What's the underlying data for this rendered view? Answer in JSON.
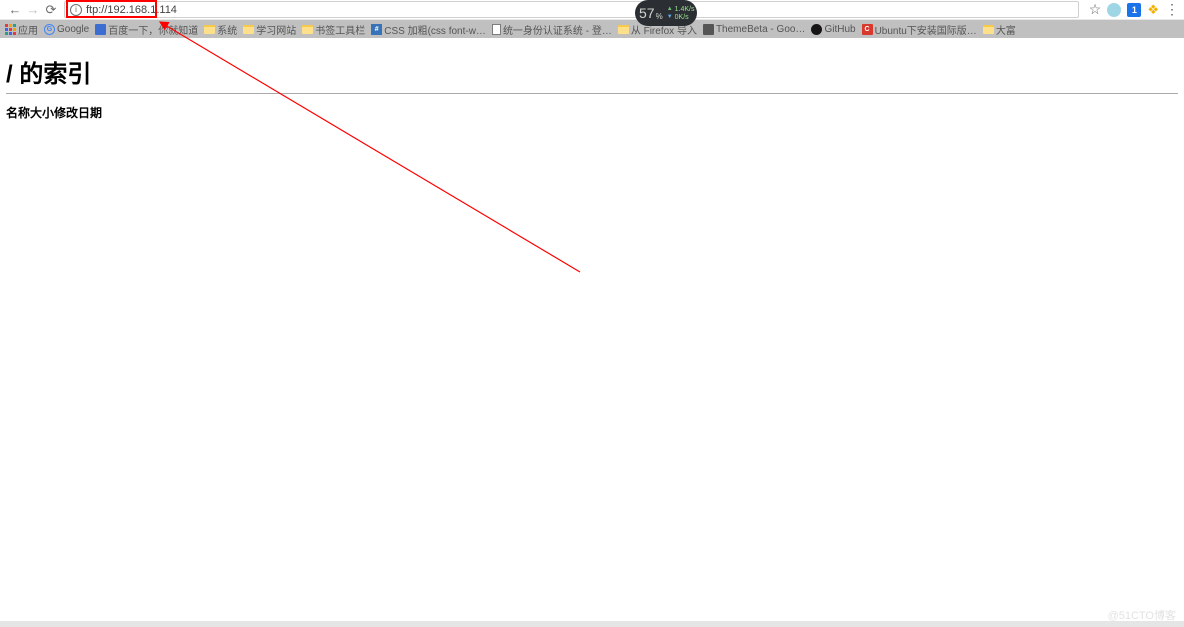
{
  "address_bar": {
    "url": "ftp://192.168.1.114"
  },
  "bookmarks": {
    "apps_label": "应用",
    "items": [
      {
        "icon": "g",
        "text": "Google"
      },
      {
        "icon": "bd",
        "text": "百度一下，你就知道"
      },
      {
        "icon": "folder",
        "text": "系统"
      },
      {
        "icon": "folder",
        "text": "学习网站"
      },
      {
        "icon": "folder",
        "text": "书签工具栏"
      },
      {
        "icon": "css",
        "text": "CSS 加粗(css font-w…"
      },
      {
        "icon": "page",
        "text": "统一身份认证系统 - 登…"
      },
      {
        "icon": "folder",
        "text": "从 Firefox 导入"
      },
      {
        "icon": "theme",
        "text": "ThemeBeta - Goo…"
      },
      {
        "icon": "gh",
        "text": "GitHub"
      },
      {
        "icon": "ubuntu",
        "text": "Ubuntu下安装国际版…"
      },
      {
        "icon": "folder",
        "text": "大富"
      }
    ]
  },
  "hud": {
    "value": "57",
    "pct": "%",
    "up": "1.4K/s",
    "down": "0K/s"
  },
  "page": {
    "title": "/ 的索引",
    "col_name": "名称",
    "col_size": "大小",
    "col_date": "修改日期"
  },
  "watermark": "@51CTO博客"
}
